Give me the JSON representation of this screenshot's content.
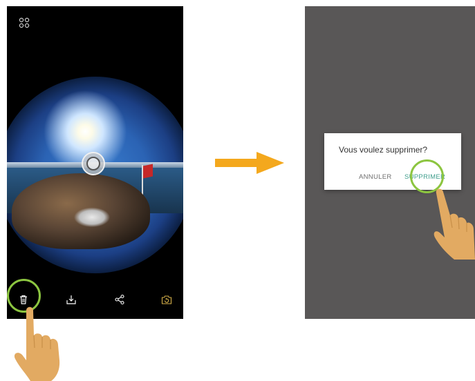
{
  "arrow": {
    "color": "#f4a81d"
  },
  "left_screen": {
    "top_icon": "grid-icon",
    "toolbar": [
      {
        "name": "trash-icon"
      },
      {
        "name": "download-icon"
      },
      {
        "name": "share-icon"
      },
      {
        "name": "reset-camera-icon"
      }
    ],
    "lens_badge": "lens-badge-icon",
    "highlight_color": "#8cc540"
  },
  "dialog": {
    "message": "Vous voulez supprimer?",
    "cancel_label": "ANNULER",
    "confirm_label": "SUPPRIMER",
    "confirm_color": "#3f9e8c"
  },
  "colors": {
    "phone_bg_left": "#000000",
    "phone_bg_right": "#595757",
    "hand": "#e2aa62",
    "reset_icon": "#d8b24a"
  }
}
